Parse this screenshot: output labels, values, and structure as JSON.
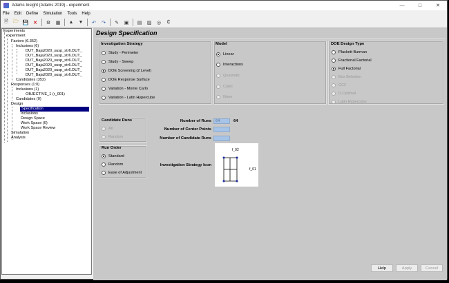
{
  "window": {
    "title": "Adams Insight (Adams 2019) - experiment"
  },
  "menu": [
    "File",
    "Edit",
    "Define",
    "Simulation",
    "Tools",
    "Help"
  ],
  "toolbar_icons": [
    "new-icon",
    "open-icon",
    "save-icon",
    "delete-icon",
    "build-icon",
    "export-icon",
    "up-icon",
    "down-icon",
    "undo-icon",
    "redo-icon",
    "edit-icon",
    "image-icon",
    "report-icon",
    "chart-icon",
    "web-icon",
    "help-icon"
  ],
  "tree": {
    "root": "Experiments",
    "experiment": "experiment",
    "factors": "Factors (6.352)",
    "inclusions": "Inclusions (6)",
    "factor_items": [
      "DUT_Baja2020_susp_str6.DUT_",
      "DUT_Baja2020_susp_str6.DUT_",
      "DUT_Baja2020_susp_str6.DUT_",
      "DUT_Baja2020_susp_str6.DUT_",
      "DUT_Baja2020_susp_str6.DUT_",
      "DUT_Baja2020_susp_str6.DUT_"
    ],
    "candidates": "Candidates (352)",
    "responses": "Responses (1:0)",
    "resp_inclusions": "Inclusions (1)",
    "objective": "OBJECTIVE_1 (r_001)",
    "resp_candidates": "Candidates (0)",
    "design": "Design",
    "specification": "Specification",
    "design_inclusions": "Inclusions",
    "design_space": "Design Space",
    "work_space": "Work Space (0)",
    "work_space_review": "Work Space Review",
    "simulation": "Simulation",
    "analysis": "Analysis"
  },
  "page_title": "Design Specification",
  "strategy": {
    "title": "Investigation Strategy",
    "options": [
      "Study - Perimeter",
      "Study - Sweep",
      "DOE Screening (2 Level)",
      "DOE Response Surface",
      "Variation - Monte Carlo",
      "Variation - Latin Hypercube"
    ],
    "selected": 2
  },
  "model": {
    "title": "Model",
    "options": [
      "Linear",
      "Interactions",
      "Quadratic",
      "Cubic",
      "None"
    ],
    "selected": 0
  },
  "doe": {
    "title": "DOE Design Type",
    "options": [
      "Plackett Burman",
      "Fractional Factorial",
      "Full Factorial",
      "Box Behnken",
      "CCF",
      "D-Optimal",
      "Latin Hypercube"
    ],
    "selected": 2
  },
  "candidate_runs": {
    "title": "Candidate Runs",
    "options": [
      "All",
      "Random"
    ]
  },
  "run_order": {
    "title": "Run Order",
    "options": [
      "Standard",
      "Random",
      "Ease of Adjustment"
    ],
    "selected": 0
  },
  "fields": {
    "num_runs_label": "Number of Runs",
    "num_runs_value": "64",
    "num_runs_display": "64",
    "center_points_label": "Number of Center Points",
    "candidate_runs_label": "Number of Candidate Runs"
  },
  "icon_label": "Investigation Strategy Icon",
  "icon_axes": {
    "top": "f_02",
    "right": "f_01"
  },
  "buttons": {
    "help": "Help",
    "apply": "Apply",
    "cancel": "Cancel"
  }
}
